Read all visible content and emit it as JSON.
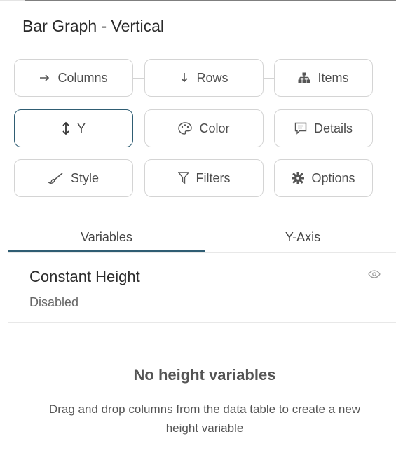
{
  "panel": {
    "title": "Bar Graph - Vertical"
  },
  "buttons": {
    "columns": {
      "label": "Columns",
      "icon": "arrow-right-icon"
    },
    "rows": {
      "label": "Rows",
      "icon": "arrow-down-icon"
    },
    "items": {
      "label": "Items",
      "icon": "hierarchy-icon"
    },
    "y": {
      "label": "Y",
      "icon": "vertical-arrows-icon",
      "selected": true
    },
    "color": {
      "label": "Color",
      "icon": "palette-icon"
    },
    "details": {
      "label": "Details",
      "icon": "comment-icon"
    },
    "style": {
      "label": "Style",
      "icon": "brush-icon"
    },
    "filters": {
      "label": "Filters",
      "icon": "funnel-icon"
    },
    "options": {
      "label": "Options",
      "icon": "gear-icon"
    }
  },
  "tabs": [
    {
      "label": "Variables",
      "active": true
    },
    {
      "label": "Y-Axis",
      "active": false
    }
  ],
  "variable": {
    "name": "Constant Height",
    "status": "Disabled",
    "icon": "eye-icon"
  },
  "empty_state": {
    "title": "No height variables",
    "description": "Drag and drop columns from the data table to create a new height variable"
  },
  "colors": {
    "accent": "#2f5d73",
    "border": "#d4d4d4",
    "text": "#4d4d4d"
  }
}
